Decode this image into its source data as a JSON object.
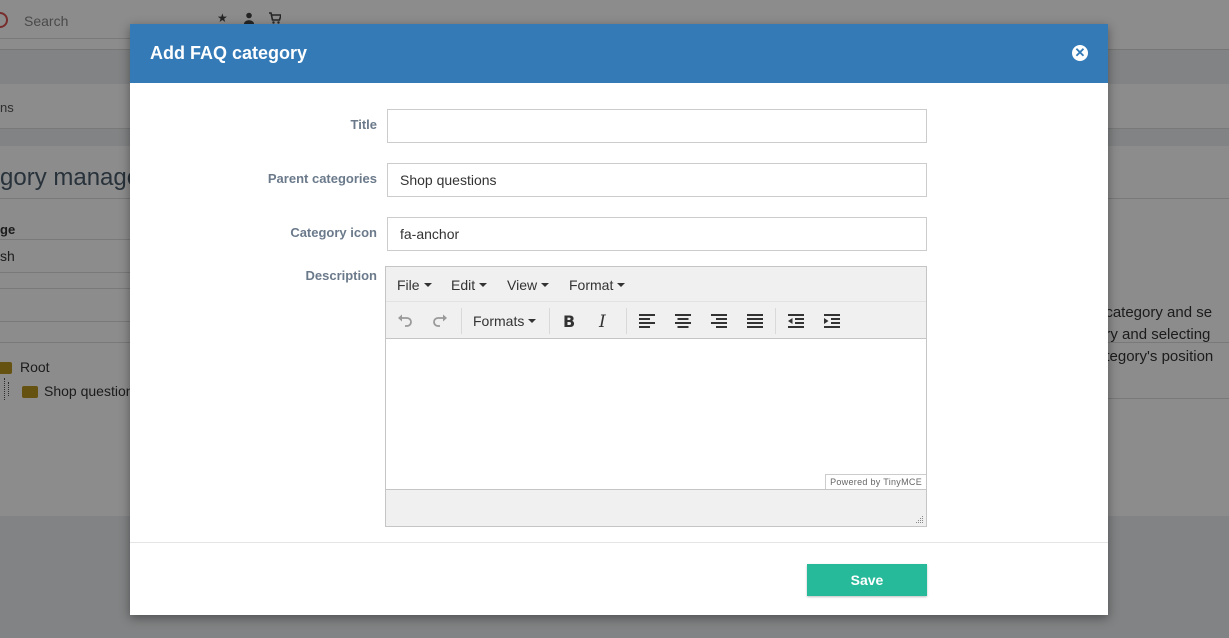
{
  "background": {
    "search_placeholder": "Search",
    "strip_text": "ns",
    "heading": "gory manage",
    "label_lang": "ge",
    "value_lang": "sh",
    "tree": {
      "root": "Root",
      "child": "Shop question"
    },
    "right_text": [
      "t category and se",
      "ory and selecting",
      "ategory's position"
    ]
  },
  "modal": {
    "title": "Add FAQ category",
    "close_icon": "close-circle-icon",
    "fields": {
      "title": {
        "label": "Title",
        "value": ""
      },
      "parent": {
        "label": "Parent categories",
        "value": "Shop questions"
      },
      "icon": {
        "label": "Category icon",
        "value": "fa-anchor"
      },
      "description": {
        "label": "Description"
      }
    },
    "editor": {
      "menus": [
        "File",
        "Edit",
        "View",
        "Format"
      ],
      "formats_label": "Formats",
      "powered_by": "Powered by TinyMCE",
      "content": ""
    },
    "save_label": "Save",
    "accent_color": "#337ab7",
    "save_color": "#26b99a"
  }
}
